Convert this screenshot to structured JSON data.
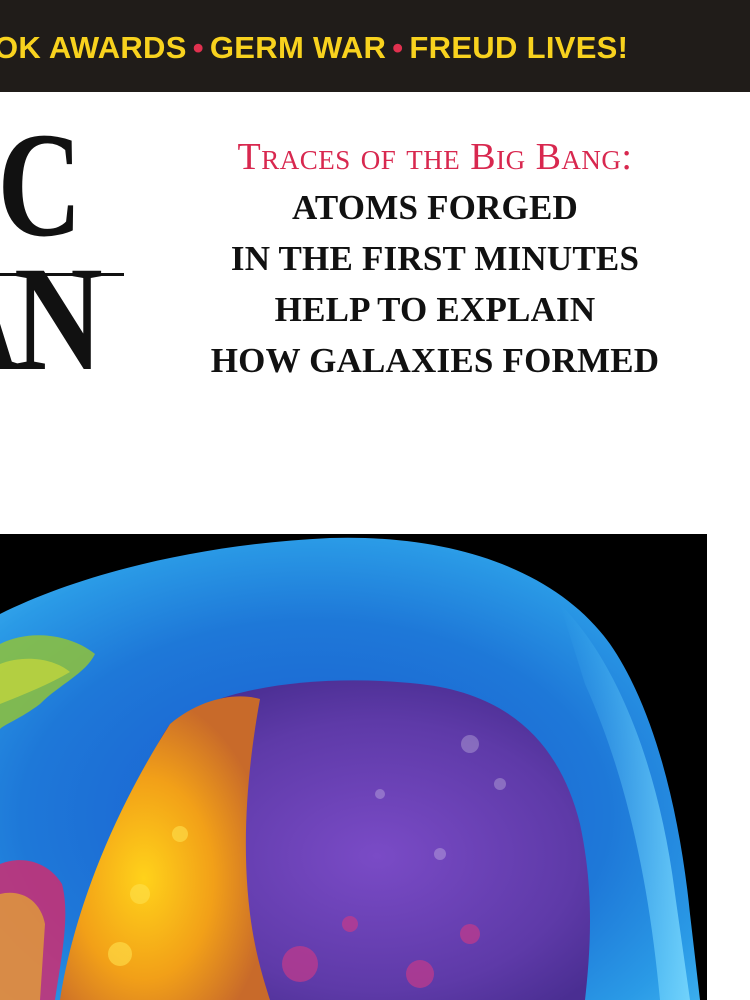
{
  "banner": {
    "items": [
      "OK AWARDS",
      "GERM WAR",
      "FREUD LIVES!"
    ]
  },
  "masthead": {
    "line1": "IC",
    "line2": "AN"
  },
  "cover_story": {
    "title": "Traces of the Big Bang:",
    "lines": [
      "ATOMS FORGED",
      "IN THE FIRST MINUTES",
      "HELP TO EXPLAIN",
      "HOW GALAXIES FORMED"
    ]
  },
  "colors": {
    "banner_bg": "#201c19",
    "banner_text": "#f8d21e",
    "separator": "#e0314f",
    "headline_accent": "#d8284f"
  },
  "image": {
    "subject": "colorful simulated early-universe sphere on black"
  }
}
